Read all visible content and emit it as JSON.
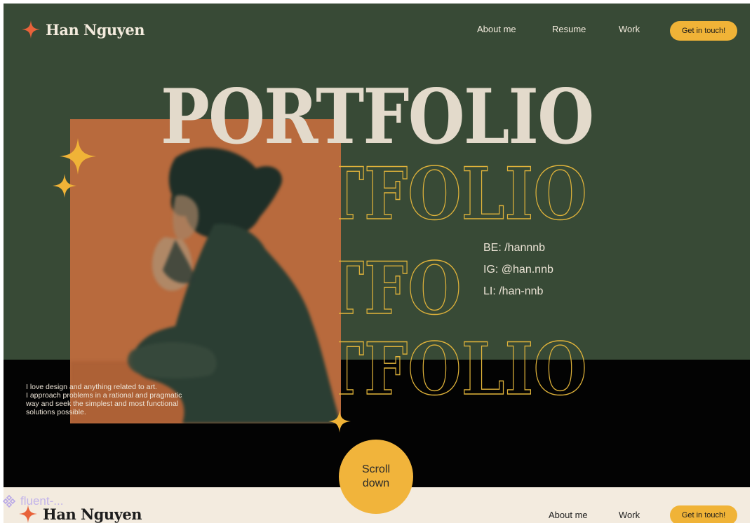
{
  "brand": {
    "name": "Han Nguyen",
    "star_icon": "four-point-star-icon",
    "star_color": "#e8623a"
  },
  "nav": {
    "about": "About me",
    "resume": "Resume",
    "work": "Work",
    "cta": "Get in touch!"
  },
  "hero": {
    "title": "PORTFOLIO",
    "outline_rows": [
      "TFOLIO",
      "TFO",
      "TFOLIO"
    ],
    "socials": [
      "BE: /hannnb",
      "IG: @han.nnb",
      "LI: /han-nnb"
    ],
    "about_lines": [
      "I love design and anything related to art.",
      "I approach problems in a rational and pragmatic",
      "way and seek the simplest and most functional",
      "solutions possible."
    ],
    "scroll": {
      "line1": "Scroll",
      "line2": "down"
    }
  },
  "next_section": {
    "brand": "Han Nguyen",
    "nav": {
      "about": "About me",
      "work": "Work",
      "cta": "Get in touch!"
    }
  },
  "overlay": {
    "label": "fluent-...",
    "icon": "diamond-grid-icon"
  },
  "colors": {
    "green": "#384a36",
    "black": "#030303",
    "cream": "#e3dacb",
    "orange": "#b86a3d",
    "yellow": "#f0b337",
    "star_orange": "#e8623a"
  }
}
